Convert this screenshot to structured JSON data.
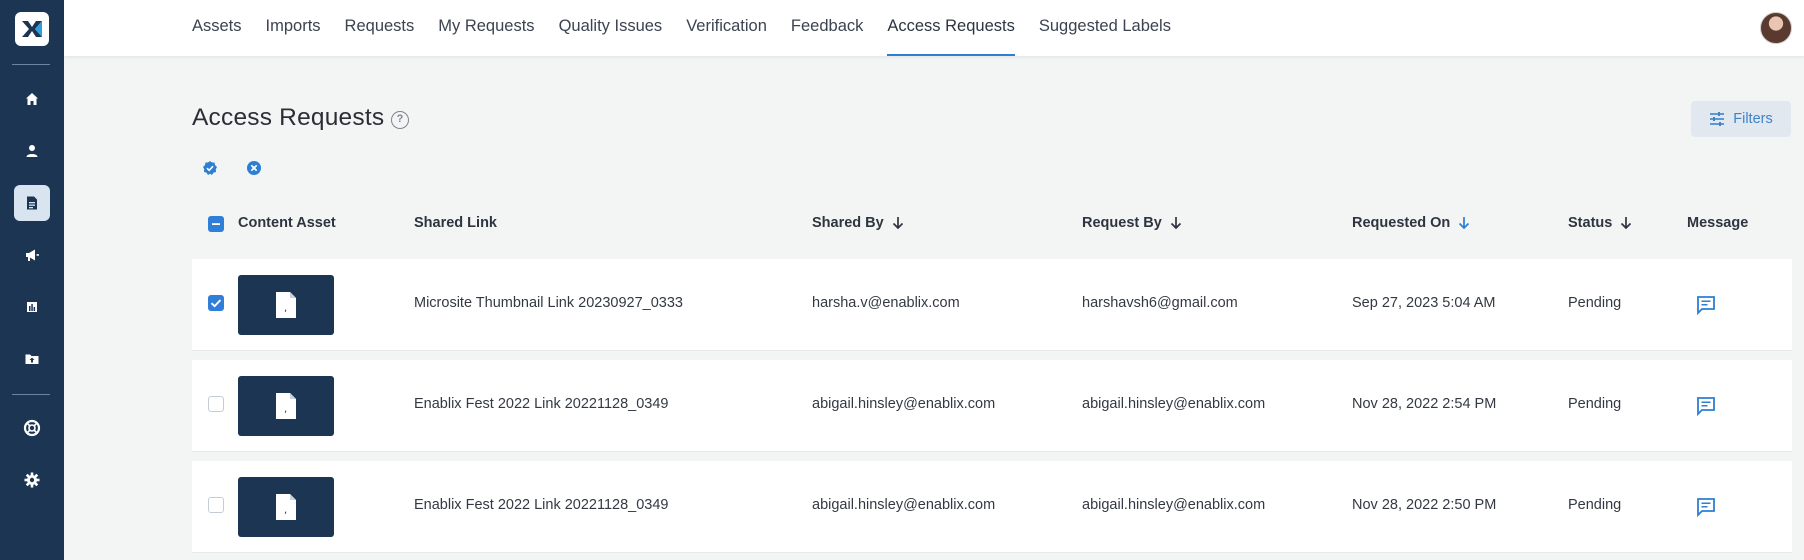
{
  "app": {
    "logo_icon": "enablix-x-logo",
    "colors": {
      "sidebar": "#1b3553",
      "accent": "#2d7fd3",
      "background": "#f3f5f4"
    }
  },
  "sidebar": {
    "items": [
      {
        "icon": "home-icon",
        "active": false
      },
      {
        "icon": "user-icon",
        "active": false
      },
      {
        "icon": "document-icon",
        "active": true
      },
      {
        "icon": "megaphone-icon",
        "active": false
      },
      {
        "icon": "bar-chart-icon",
        "active": false
      },
      {
        "icon": "folder-upload-icon",
        "active": false
      },
      {
        "icon": "lifebuoy-icon",
        "active": false
      },
      {
        "icon": "settings-gear-icon",
        "active": false
      }
    ]
  },
  "nav": {
    "tabs": [
      {
        "label": "Assets",
        "active": false
      },
      {
        "label": "Imports",
        "active": false
      },
      {
        "label": "Requests",
        "active": false
      },
      {
        "label": "My Requests",
        "active": false
      },
      {
        "label": "Quality Issues",
        "active": false
      },
      {
        "label": "Verification",
        "active": false
      },
      {
        "label": "Feedback",
        "active": false
      },
      {
        "label": "Access Requests",
        "active": true
      },
      {
        "label": "Suggested Labels",
        "active": false
      }
    ]
  },
  "page": {
    "title": "Access Requests",
    "help_icon": "?",
    "filters_label": "Filters"
  },
  "table": {
    "columns": {
      "content_asset": "Content Asset",
      "shared_link": "Shared Link",
      "shared_by": "Shared By",
      "request_by": "Request By",
      "requested_on": "Requested On",
      "status": "Status",
      "message": "Message"
    },
    "rows": [
      {
        "checked": true,
        "shared_link": "Microsite Thumbnail Link 20230927_0333",
        "shared_by": "harsha.v@enablix.com",
        "request_by": "harshavsh6@gmail.com",
        "requested_on": "Sep 27, 2023 5:04 AM",
        "status": "Pending"
      },
      {
        "checked": false,
        "shared_link": "Enablix Fest 2022 Link 20221128_0349",
        "shared_by": "abigail.hinsley@enablix.com",
        "request_by": "abigail.hinsley@enablix.com",
        "requested_on": "Nov 28, 2022 2:54 PM",
        "status": "Pending"
      },
      {
        "checked": false,
        "shared_link": "Enablix Fest 2022 Link 20221128_0349",
        "shared_by": "abigail.hinsley@enablix.com",
        "request_by": "abigail.hinsley@enablix.com",
        "requested_on": "Nov 28, 2022 2:50 PM",
        "status": "Pending"
      }
    ]
  }
}
